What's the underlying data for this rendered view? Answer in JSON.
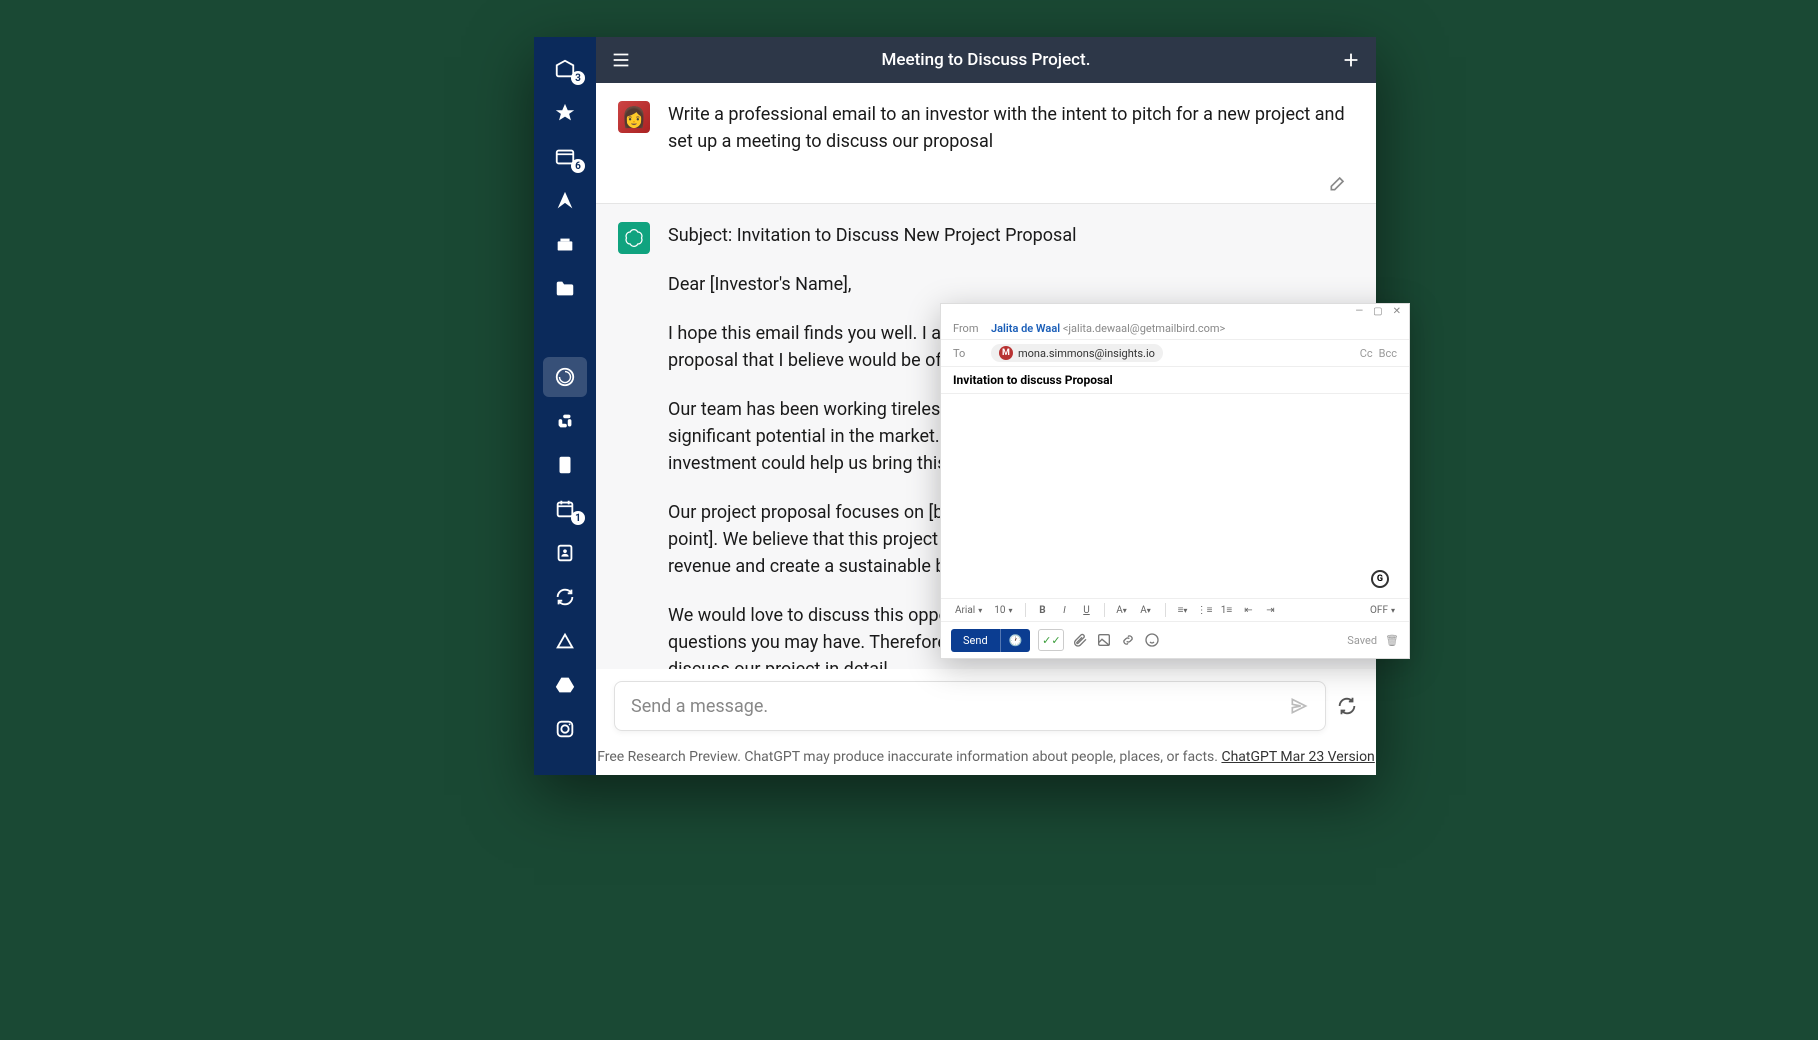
{
  "header": {
    "title": "Meeting to Discuss Project."
  },
  "sidebar": {
    "items": [
      {
        "name": "inbox",
        "badge": "3"
      },
      {
        "name": "star",
        "badge": null
      },
      {
        "name": "archive",
        "badge": "6"
      },
      {
        "name": "sent",
        "badge": null
      },
      {
        "name": "storage",
        "badge": null
      },
      {
        "name": "folder",
        "badge": null
      },
      {
        "name": "chatgpt",
        "badge": null,
        "active": true
      },
      {
        "name": "slack",
        "badge": null
      },
      {
        "name": "doc",
        "badge": null
      },
      {
        "name": "calendar",
        "badge": "1"
      },
      {
        "name": "contacts",
        "badge": null
      },
      {
        "name": "refresh",
        "badge": null
      },
      {
        "name": "triangle",
        "badge": null
      },
      {
        "name": "drive",
        "badge": null
      },
      {
        "name": "instagram",
        "badge": null
      }
    ]
  },
  "chat": {
    "user_prompt": "Write a professional email to an investor with the intent to pitch for a new project and set up a meeting to discuss our proposal",
    "assistant": {
      "subject_line": "Subject: Invitation to Discuss New Project Proposal",
      "greeting": "Dear [Investor's Name],",
      "p1": "I hope this email finds you well. I am reaching out to you regarding a new project proposal that I believe would be of great interest to you.",
      "p2": "Our team has been working tirelessly to develop a project that we believe has significant potential in the market. We are confident that your expertise and investment could help us bring this project to fruition and make it a great success.",
      "p3": "Our project proposal focuses on [briefly describe the project and its unique selling point]. We believe that this project has a strong potential to generate significant revenue and create a sustainable business model.",
      "p4": "We would love to discuss this opportunity with you in person and answer any questions you may have. Therefore, we would like to invite you to a meeting to discuss our project in detail."
    },
    "input_placeholder": "Send a message.",
    "footer_text": "Free Research Preview. ChatGPT may produce inaccurate information about people, places, or facts. ",
    "footer_link": "ChatGPT Mar 23 Version"
  },
  "compose": {
    "from_label": "From",
    "from_name": "Jalita de Waal",
    "from_email": "<jalita.dewaal@getmailbird.com>",
    "to_label": "To",
    "to_chip_initial": "M",
    "to_chip_email": "mona.simmons@insights.io",
    "cc": "Cc",
    "bcc": "Bcc",
    "subject": "Invitation to discuss Proposal",
    "font_family": "Arial",
    "font_size": "10",
    "tracking": "OFF",
    "send": "Send",
    "saved": "Saved"
  }
}
